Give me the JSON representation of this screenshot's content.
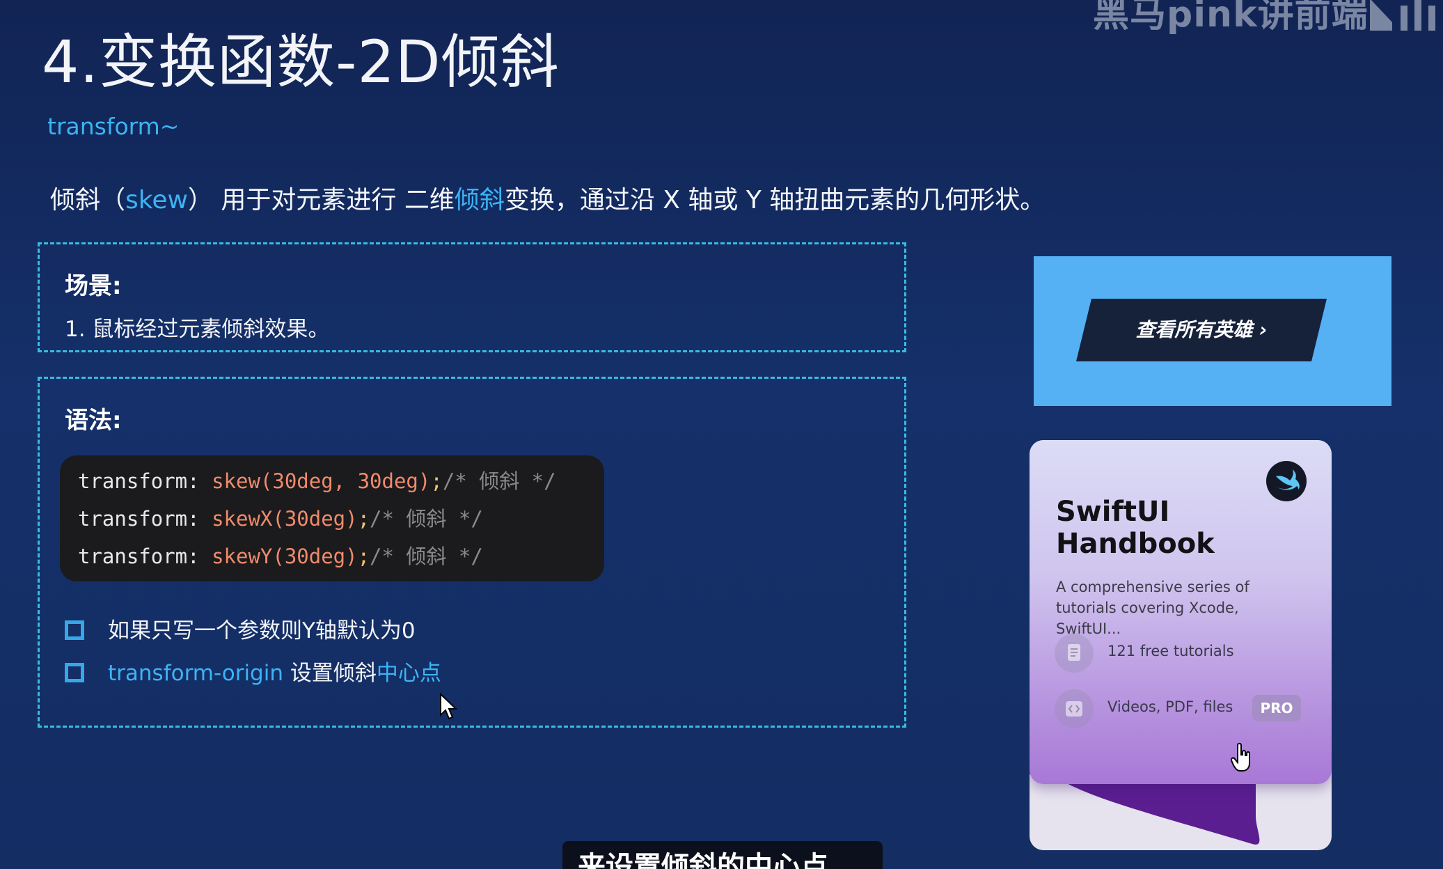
{
  "watermark": {
    "text": "黑马pink讲前端"
  },
  "slide": {
    "title": "4.变换函数-2D倾斜",
    "subtitle": "transform~",
    "description": {
      "part1": "倾斜（",
      "part2": "skew",
      "part3": "） 用于对元素进行 二维",
      "part4": "倾斜",
      "part5": "变换，通过沿 X 轴或 Y 轴扭曲元素的几何形状。"
    },
    "scenario": {
      "heading": "场景:",
      "item": "1. 鼠标经过元素倾斜效果。"
    },
    "syntax": {
      "heading": "语法:",
      "code": [
        {
          "prop": "transform: ",
          "fn": "skew(30deg, 30deg)",
          "punct": ";",
          "comment": "/* 倾斜 */"
        },
        {
          "prop": "transform: ",
          "fn": "skewX(30deg)",
          "punct": ";",
          "comment": "/* 倾斜 */"
        },
        {
          "prop": "transform: ",
          "fn": "skewY(30deg)",
          "punct": ";",
          "comment": "/* 倾斜 */"
        }
      ],
      "bullets": {
        "first": "如果只写一个参数则Y轴默认为0",
        "second_a": "transform-origin",
        "second_b": " 设置倾斜",
        "second_c": "中心点"
      }
    }
  },
  "banner": {
    "button_label": "查看所有英雄 ›",
    "background": "#55b0f4",
    "button_color": "#16213a"
  },
  "card": {
    "title": "SwiftUI Handbook",
    "description": "A comprehensive series of tutorials covering Xcode, SwiftUI...",
    "rows": [
      {
        "icon": "document-icon",
        "text": "121 free tutorials"
      },
      {
        "icon": "code-icon",
        "text": "Videos, PDF, files",
        "badge": "PRO"
      }
    ]
  },
  "caption": {
    "text": "来设置倾斜的中心点"
  },
  "colors": {
    "background": "#142e64",
    "accent": "#3cb4f4",
    "dash_border": "#38bde0"
  }
}
